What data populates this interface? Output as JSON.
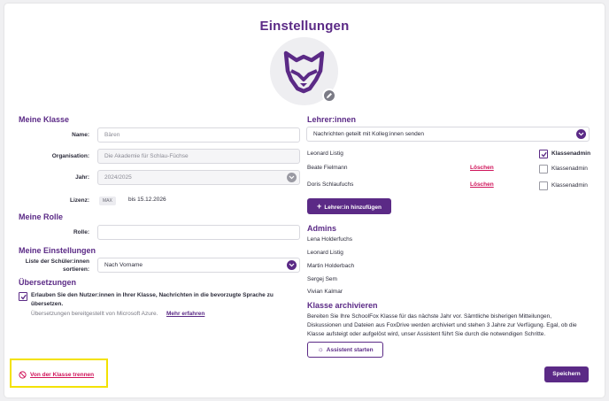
{
  "page": {
    "title": "Einstellungen"
  },
  "icons": {
    "avatar": "fox-icon",
    "edit": "pencil-icon",
    "chevron": "chevron-down-icon",
    "plus": "plus-icon",
    "assistant": "sparkle-icon",
    "leave": "prohibit-icon",
    "check": "check-icon"
  },
  "colors": {
    "accent": "#5b2a86",
    "danger": "#d0145a",
    "highlight": "#f3e200"
  },
  "my_class": {
    "heading": "Meine Klasse",
    "name_label": "Name:",
    "name_placeholder": "Bären",
    "org_label": "Organisation:",
    "org_placeholder": "Die Akademie für Schlau-Füchse",
    "year_label": "Jahr:",
    "year_value": "2024/2025",
    "license_label": "Lizenz:",
    "license_badge": "MAX",
    "license_until": "bis 15.12.2026"
  },
  "my_role": {
    "heading": "Meine Rolle",
    "role_label": "Rolle:",
    "role_value": ""
  },
  "my_settings": {
    "heading": "Meine Einstellungen",
    "sort_label_1": "Liste der Schüler:innen",
    "sort_label_2": "sortieren:",
    "sort_value": "Nach Vorname"
  },
  "translations": {
    "heading": "Übersetzungen",
    "allow_text_1": "Erlauben Sie den Nutzer:innen in Ihrer Klasse, Nachrichten in die bevorzugte Sprache zu",
    "allow_text_2": "übersetzen.",
    "provided_by": "Übersetzungen bereitgestellt von Microsoft Azure.",
    "learn_more": "Mehr erfahren",
    "allow_checked": true
  },
  "teachers": {
    "heading": "Lehrer:innen",
    "sharing_value": "Nachrichten geteilt mit Kolleg:innen senden",
    "list": [
      {
        "name": "Leonard Listig",
        "delete": "",
        "admin_label": "Klassenadmin",
        "admin": true
      },
      {
        "name": "Beate Fielmann",
        "delete": "Löschen",
        "admin_label": "Klassenadmin",
        "admin": false
      },
      {
        "name": "Doris Schlaufuchs",
        "delete": "Löschen",
        "admin_label": "Klassenadmin",
        "admin": false
      }
    ],
    "add_button": "Lehrer:in hinzufügen"
  },
  "admins": {
    "heading": "Admins",
    "list": [
      "Lena Holderfuchs",
      "Leonard Listig",
      "Martin Holderbach",
      "Sergej Sem",
      "Vivian Kalmar"
    ]
  },
  "archive": {
    "heading": "Klasse archivieren",
    "text_1": "Bereiten Sie Ihre SchoolFox Klasse für das nächste Jahr vor. Sämtliche bisherigen Mitteilungen,",
    "text_2": "Diskussionen und Dateien aus FoxDrive werden archiviert und stehen 3 Jahre zur Verfügung. Egal, ob die",
    "text_3": "Klasse aufsteigt oder aufgelöst wird, unser Assistent führt Sie durch die notwendigen Schritte.",
    "button": "Assistent starten"
  },
  "footer": {
    "leave_link": "Von der Klasse trennen",
    "save_button": "Speichern"
  }
}
